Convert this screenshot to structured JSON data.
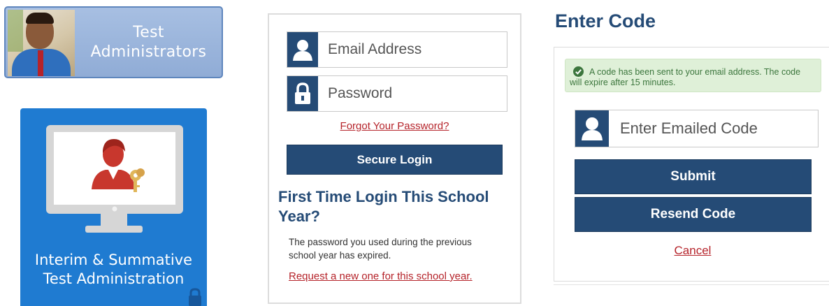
{
  "test_admin_card": {
    "title_line1": "Test",
    "title_line2": "Administrators"
  },
  "interim_card": {
    "title_line1": "Interim & Summative",
    "title_line2": "Test Administration",
    "icons": [
      "monitor-icon",
      "administrator-icon",
      "lock-icon"
    ]
  },
  "login": {
    "email_placeholder": "Email Address",
    "password_placeholder": "Password",
    "forgot_link": "Forgot Your Password?",
    "secure_login_button": "Secure Login",
    "first_time_heading_line1": "First Time Login This School",
    "first_time_heading_line2": "Year?",
    "first_time_text_line1": "The password you used during the previous",
    "first_time_text_line2": "school year has expired.",
    "request_link": "Request a new one for this school year."
  },
  "enter_code": {
    "heading": "Enter Code",
    "alert_line1": "A code has been sent to your email address. The code",
    "alert_line2": "will expire after 15 minutes.",
    "code_placeholder": "Enter Emailed Code",
    "submit_button": "Submit",
    "resend_button": "Resend Code",
    "cancel_link": "Cancel"
  },
  "colors": {
    "navy": "#254b76",
    "link_red": "#b5232a",
    "tile_blue": "#1f7bd1",
    "card_blue": "#90acd6",
    "alert_green_bg": "#dff0d8",
    "alert_green_text": "#3c763d"
  }
}
